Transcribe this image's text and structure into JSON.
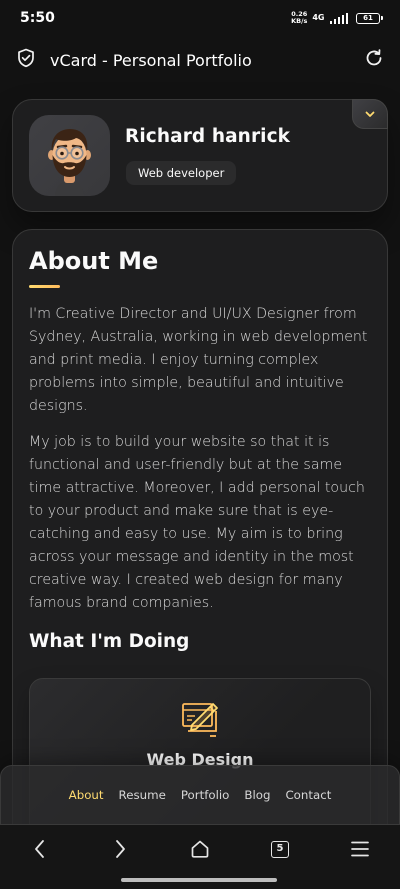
{
  "status_bar": {
    "time": "5:50",
    "net_speed_value": "0.26",
    "net_speed_unit": "KB/s",
    "network": "4G",
    "battery": "61"
  },
  "browser": {
    "title": "vCard - Personal Portfolio",
    "shield_icon": "shield-check-icon",
    "reload_icon": "reload-icon"
  },
  "profile": {
    "name": "Richard hanrick",
    "role": "Web developer",
    "avatar": "avatar-memoji",
    "show_contacts_icon": "chevron-down-icon"
  },
  "about": {
    "title": "About Me",
    "paragraph_1": "I'm Creative Director and UI/UX Designer from Sydney, Australia, working in web development and print media. I enjoy turning complex problems into simple, beautiful and intuitive designs.",
    "paragraph_2": "My job is to build your website so that it is functional and user-friendly but at the same time attractive. Moreover, I add personal touch to your product and make sure that is eye-catching and easy to use. My aim is to bring across your message and identity in the most creative way. I created web design for many famous brand companies.",
    "services_title": "What I'm Doing",
    "services": [
      {
        "title": "Web Design",
        "icon": "design-icon"
      }
    ]
  },
  "navbar": {
    "items": [
      {
        "label": "About",
        "active": true
      },
      {
        "label": "Resume",
        "active": false
      },
      {
        "label": "Portfolio",
        "active": false
      },
      {
        "label": "Blog",
        "active": false
      },
      {
        "label": "Contact",
        "active": false
      }
    ]
  },
  "system_nav": {
    "tab_count": "5"
  },
  "colors": {
    "accent": "#ffdb70",
    "background": "#121212",
    "card": "#1e1e1f",
    "text": "#d6d6d6"
  }
}
